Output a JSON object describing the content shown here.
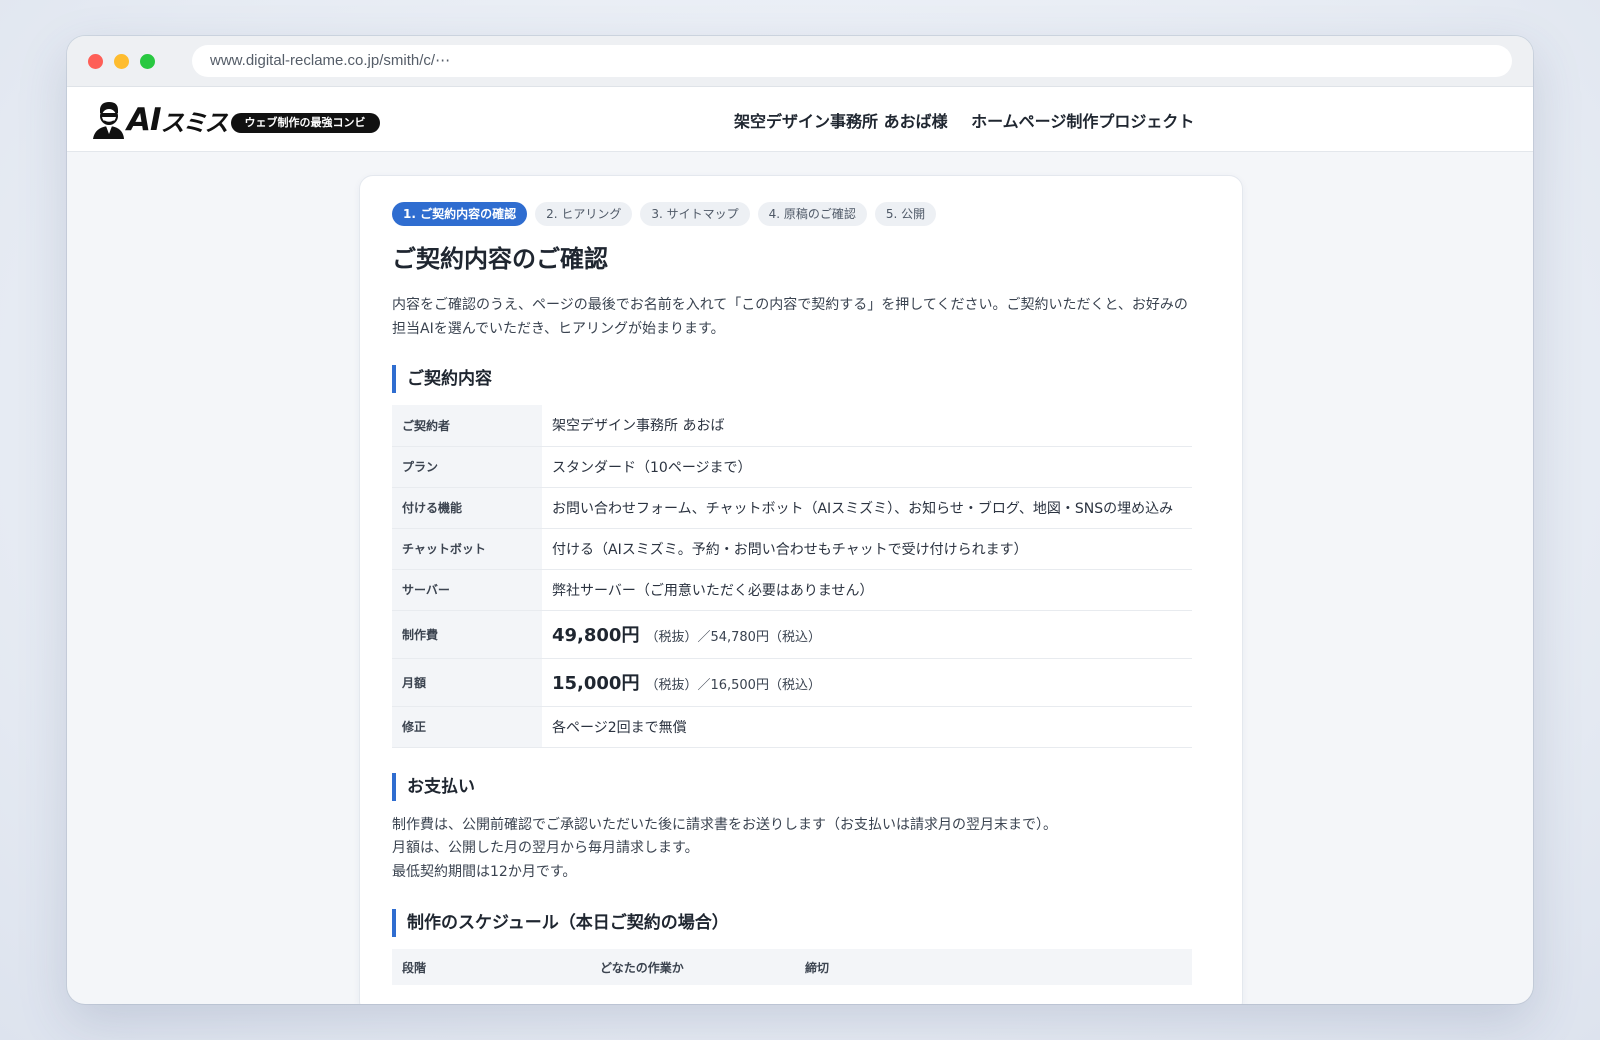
{
  "browser": {
    "url": "www.digital-reclame.co.jp/smith/c/⋯"
  },
  "header": {
    "logo_ai": "AI",
    "logo_kana": "スミス",
    "logo_badge": "ウェブ制作の最強コンビ",
    "client_name": "架空デザイン事務所 あおば様",
    "project_name": "ホームページ制作プロジェクト"
  },
  "steps": [
    {
      "label": "1. ご契約内容の確認",
      "active": true
    },
    {
      "label": "2. ヒアリング",
      "active": false
    },
    {
      "label": "3. サイトマップ",
      "active": false
    },
    {
      "label": "4. 原稿のご確認",
      "active": false
    },
    {
      "label": "5. 公開",
      "active": false
    }
  ],
  "page": {
    "title": "ご契約内容のご確認",
    "intro_line1": "内容をご確認のうえ、ページの最後でお名前を入れて「この内容で契約する」を押してください。ご契約いただくと、お好みの",
    "intro_line2": "担当AIを選んでいただき、ヒアリングが始まります。"
  },
  "contract": {
    "heading": "ご契約内容",
    "rows": {
      "contractor": {
        "label": "ご契約者",
        "value": "架空デザイン事務所 あおば"
      },
      "plan": {
        "label": "プラン",
        "value": "スタンダード（10ページまで）"
      },
      "features": {
        "label": "付ける機能",
        "value": "お問い合わせフォーム、チャットボット（AIスミズミ）、お知らせ・ブログ、地図・SNSの埋め込み"
      },
      "chatbot": {
        "label": "チャットボット",
        "value": "付ける（AIスミズミ。予約・お問い合わせもチャットで受け付けられます）"
      },
      "server": {
        "label": "サーバー",
        "value": "弊社サーバー（ご用意いただく必要はありません）"
      },
      "production_fee": {
        "label": "制作費",
        "price": "49,800円",
        "note": "（税抜）／54,780円（税込）"
      },
      "monthly_fee": {
        "label": "月額",
        "price": "15,000円",
        "note": "（税抜）／16,500円（税込）"
      },
      "revision": {
        "label": "修正",
        "value": "各ページ2回まで無償"
      }
    }
  },
  "payment": {
    "heading": "お支払い",
    "line1": "制作費は、公開前確認でご承認いただいた後に請求書をお送りします（お支払いは請求月の翌月末まで）。",
    "line2": "月額は、公開した月の翌月から毎月請求します。",
    "line3": "最低契約期間は12か月です。"
  },
  "schedule": {
    "heading": "制作のスケジュール（本日ご契約の場合）",
    "columns": {
      "stage": "段階",
      "who": "どなたの作業か",
      "deadline": "締切"
    }
  }
}
